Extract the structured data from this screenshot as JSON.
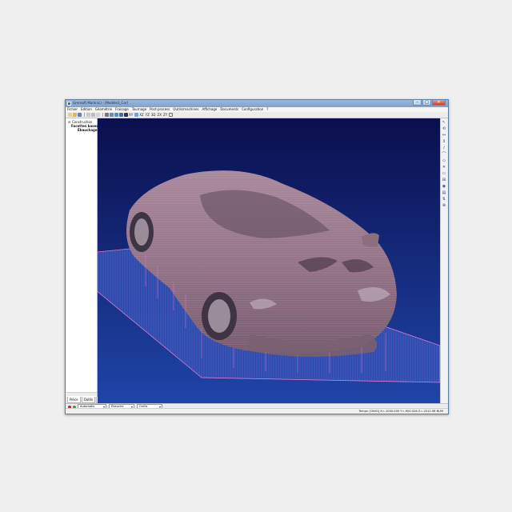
{
  "window": {
    "title": "Grensoft Marlin(c) - [Modèle1_Car]"
  },
  "menu": [
    "Fichier",
    "Edition",
    "Géométrie",
    "Fraisage",
    "Tournage",
    "Post-process",
    "Outils/machines",
    "Affichage",
    "Documents",
    "Configuration",
    "?"
  ],
  "toolbar": {
    "labels": [
      "XY",
      "XZ",
      "YZ",
      "3D",
      "ZX",
      "ZY"
    ]
  },
  "tree": {
    "root": "Construction",
    "item1": "Facettes bases",
    "item2": "Ébauchage (1)"
  },
  "left_tabs": [
    "Pièce",
    "Outils",
    "Calculs"
  ],
  "right_tools": [
    "↖",
    "⟲",
    "↔",
    "↕",
    "∕",
    "⌒",
    "◇",
    "✕",
    "▭",
    "⊞",
    "◉",
    "▤",
    "⇅",
    "⊕"
  ],
  "bottom": {
    "mode": "Automatic",
    "combo2": "Ébauche",
    "combo3": "Outils"
  },
  "status": {
    "text": "Temps: [0h00] X=-1000.000 Y=-900.326 Z=-2512.98 NUM"
  },
  "colors": {
    "viewport_top": "#0a0f4d",
    "viewport_bottom": "#1f45a8",
    "toolpath": "#e17bd0",
    "car_body": "#8c6e80"
  }
}
